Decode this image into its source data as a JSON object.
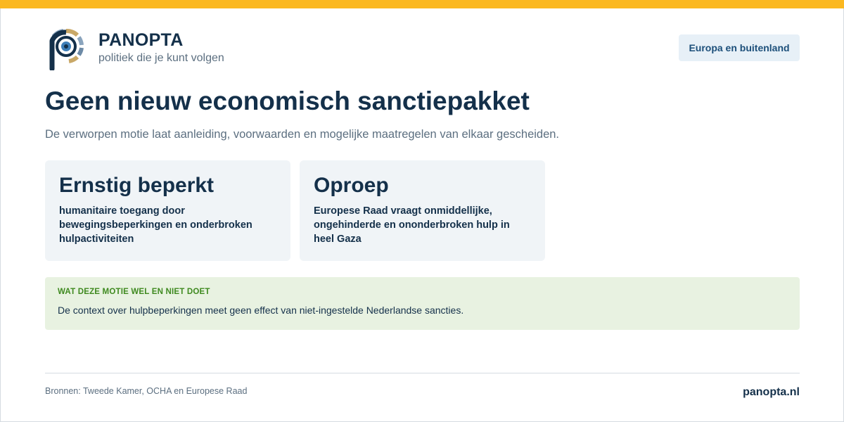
{
  "brand": {
    "name": "PANOPTA",
    "tagline": "politiek die je kunt volgen"
  },
  "category": "Europa en buitenland",
  "page": {
    "title": "Geen nieuw economisch sanctiepakket",
    "subtitle": "De verworpen motie laat aanleiding, voorwaarden en mogelijke maatregelen van elkaar gescheiden."
  },
  "cards": [
    {
      "title": "Ernstig beperkt",
      "text": "humanitaire toegang door bewegingsbeperkingen en onderbroken hulpactiviteiten"
    },
    {
      "title": "Oproep",
      "text": "Europese Raad vraagt onmiddellijke, ongehinderde en ononderbroken hulp in heel Gaza"
    }
  ],
  "note": {
    "label": "WAT DEZE MOTIE WEL EN NIET DOET",
    "text": "De context over hulpbeperkingen meet geen effect van niet-ingestelde Nederlandse sancties."
  },
  "footer": {
    "sources": "Bronnen: Tweede Kamer, OCHA en Europese Raad",
    "site": "panopta.nl"
  },
  "colors": {
    "accent": "#fbb820",
    "primary_text": "#14304a",
    "muted_text": "#5c6f80",
    "badge_bg": "#e7f0f7",
    "card_bg": "#f0f4f7",
    "note_bg": "#e8f2e1",
    "note_label": "#3f8a20"
  },
  "icons": {
    "logo": "panopta-eye-logo"
  }
}
